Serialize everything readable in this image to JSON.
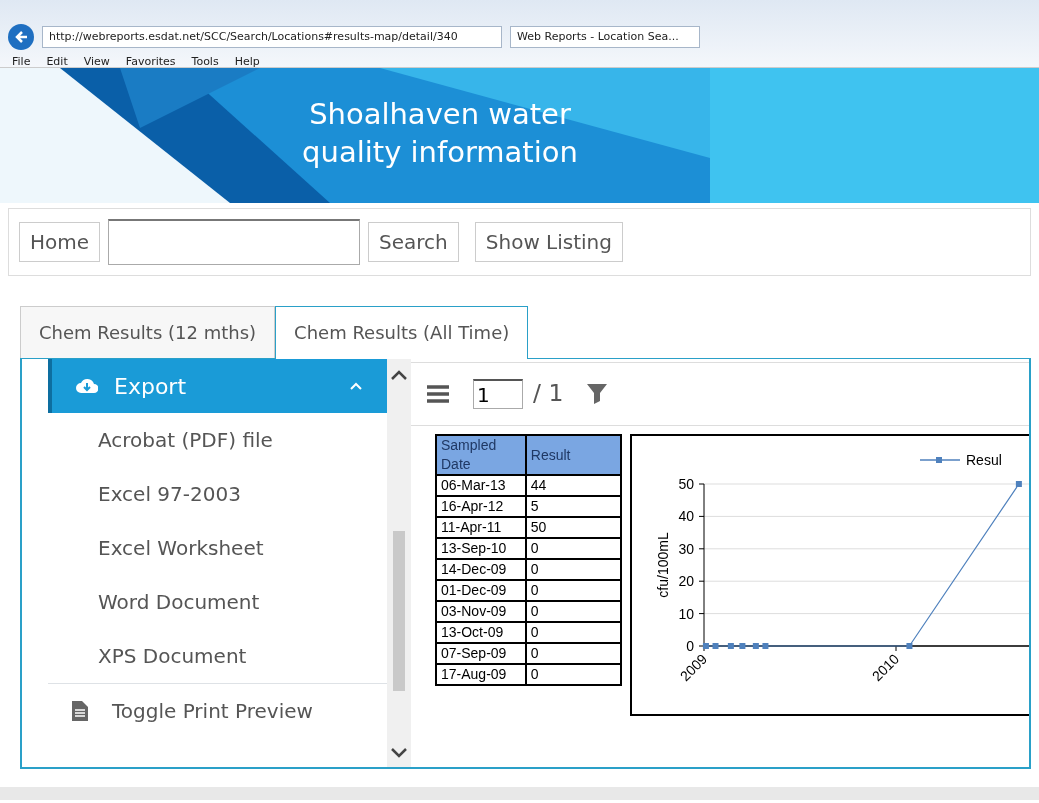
{
  "browser": {
    "url": "http://webreports.esdat.net/SCC/Search/Locations#results-map/detail/340",
    "tab_title": "Web Reports - Location Sea...",
    "menu": [
      "File",
      "Edit",
      "View",
      "Favorites",
      "Tools",
      "Help"
    ]
  },
  "banner": {
    "title": "Shoalhaven water quality information"
  },
  "toolbar": {
    "home": "Home",
    "search": "Search",
    "show_listing": "Show Listing"
  },
  "tabs": [
    {
      "label": "Chem Results (12 mths)",
      "selected": false
    },
    {
      "label": "Chem Results (All Time)",
      "selected": true
    }
  ],
  "export_menu": {
    "title": "Export",
    "expanded": true,
    "items": [
      "Acrobat (PDF) file",
      "Excel 97-2003",
      "Excel Worksheet",
      "Word Document",
      "XPS Document"
    ],
    "toggle": "Toggle Print Preview"
  },
  "report_toolbar": {
    "page": "1",
    "of": "/ 1"
  },
  "table": {
    "columns": [
      "Sampled Date",
      "Result"
    ],
    "rows": [
      [
        "06-Mar-13",
        "44"
      ],
      [
        "16-Apr-12",
        "5"
      ],
      [
        "11-Apr-11",
        "50"
      ],
      [
        "13-Sep-10",
        "0"
      ],
      [
        "14-Dec-09",
        "0"
      ],
      [
        "01-Dec-09",
        "0"
      ],
      [
        "03-Nov-09",
        "0"
      ],
      [
        "13-Oct-09",
        "0"
      ],
      [
        "07-Sep-09",
        "0"
      ],
      [
        "17-Aug-09",
        "0"
      ]
    ]
  },
  "chart_data": {
    "type": "line",
    "ylabel": "cfu/100mL",
    "x": [
      2009.01,
      2009.06,
      2009.14,
      2009.2,
      2009.27,
      2009.32,
      2010.07,
      2010.64
    ],
    "grid": true,
    "series": [
      {
        "name": "Resul",
        "color": "#4f81bd",
        "marker": "square",
        "values": [
          0,
          0,
          0,
          0,
          0,
          0,
          0,
          50
        ]
      }
    ],
    "xlim": [
      2009,
      2010.75
    ],
    "ylim": [
      0,
      50
    ],
    "xticks": [
      2009,
      2010
    ],
    "yticks": [
      0,
      10,
      20,
      30,
      40,
      50
    ]
  }
}
